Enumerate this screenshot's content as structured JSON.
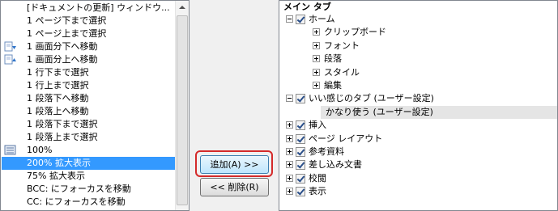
{
  "left_list": {
    "items": [
      {
        "label": "[ドキュメントの更新] ウィンドウ...",
        "icon": "none"
      },
      {
        "label": "1 ページ下まで選択",
        "icon": "none"
      },
      {
        "label": "1 ページ上まで選択",
        "icon": "none"
      },
      {
        "label": "1 画面分下へ移動",
        "icon": "page-down-icon"
      },
      {
        "label": "1 画面分上へ移動",
        "icon": "page-up-icon"
      },
      {
        "label": "1 行下まで選択",
        "icon": "none"
      },
      {
        "label": "1 行上まで選択",
        "icon": "none"
      },
      {
        "label": "1 段落下へ移動",
        "icon": "none"
      },
      {
        "label": "1 段落上へ移動",
        "icon": "none"
      },
      {
        "label": "1 段落下まで選択",
        "icon": "none"
      },
      {
        "label": "1 段落上まで選択",
        "icon": "none"
      },
      {
        "label": "100%",
        "icon": "zoom-100-icon"
      },
      {
        "label": "200% 拡大表示",
        "icon": "none",
        "selected": true
      },
      {
        "label": "75% 拡大表示",
        "icon": "none"
      },
      {
        "label": "BCC: にフォーカスを移動",
        "icon": "none"
      },
      {
        "label": "CC: にフォーカスを移動",
        "icon": "none"
      }
    ]
  },
  "buttons": {
    "add_label": "追加(A) >>",
    "remove_label": "<< 削除(R)"
  },
  "right_tree": {
    "header": "メイン タブ",
    "items": [
      {
        "label": "ホーム",
        "level": 0,
        "expander": "minus",
        "checkbox": true
      },
      {
        "label": "クリップボード",
        "level": 1,
        "expander": "plus",
        "checkbox": false
      },
      {
        "label": "フォント",
        "level": 1,
        "expander": "plus",
        "checkbox": false
      },
      {
        "label": "段落",
        "level": 1,
        "expander": "plus",
        "checkbox": false
      },
      {
        "label": "スタイル",
        "level": 1,
        "expander": "plus",
        "checkbox": false
      },
      {
        "label": "編集",
        "level": 1,
        "expander": "plus",
        "checkbox": false
      },
      {
        "label": "いい感じのタブ (ユーザー設定)",
        "level": 0,
        "expander": "minus",
        "checkbox": true
      },
      {
        "label": "かなり使う (ユーザー設定)",
        "level": 1,
        "expander": "none",
        "checkbox": false,
        "highlighted": true
      },
      {
        "label": "挿入",
        "level": 0,
        "expander": "plus",
        "checkbox": true
      },
      {
        "label": "ページ レイアウト",
        "level": 0,
        "expander": "plus",
        "checkbox": true
      },
      {
        "label": "参考資料",
        "level": 0,
        "expander": "plus",
        "checkbox": true
      },
      {
        "label": "差し込み文書",
        "level": 0,
        "expander": "plus",
        "checkbox": true
      },
      {
        "label": "校閲",
        "level": 0,
        "expander": "plus",
        "checkbox": true
      },
      {
        "label": "表示",
        "level": 0,
        "expander": "plus",
        "checkbox": true
      }
    ]
  },
  "colors": {
    "selection": "#3399ff",
    "focus_ring": "#d42a2a",
    "highlight_row": "#e5e5e5"
  }
}
